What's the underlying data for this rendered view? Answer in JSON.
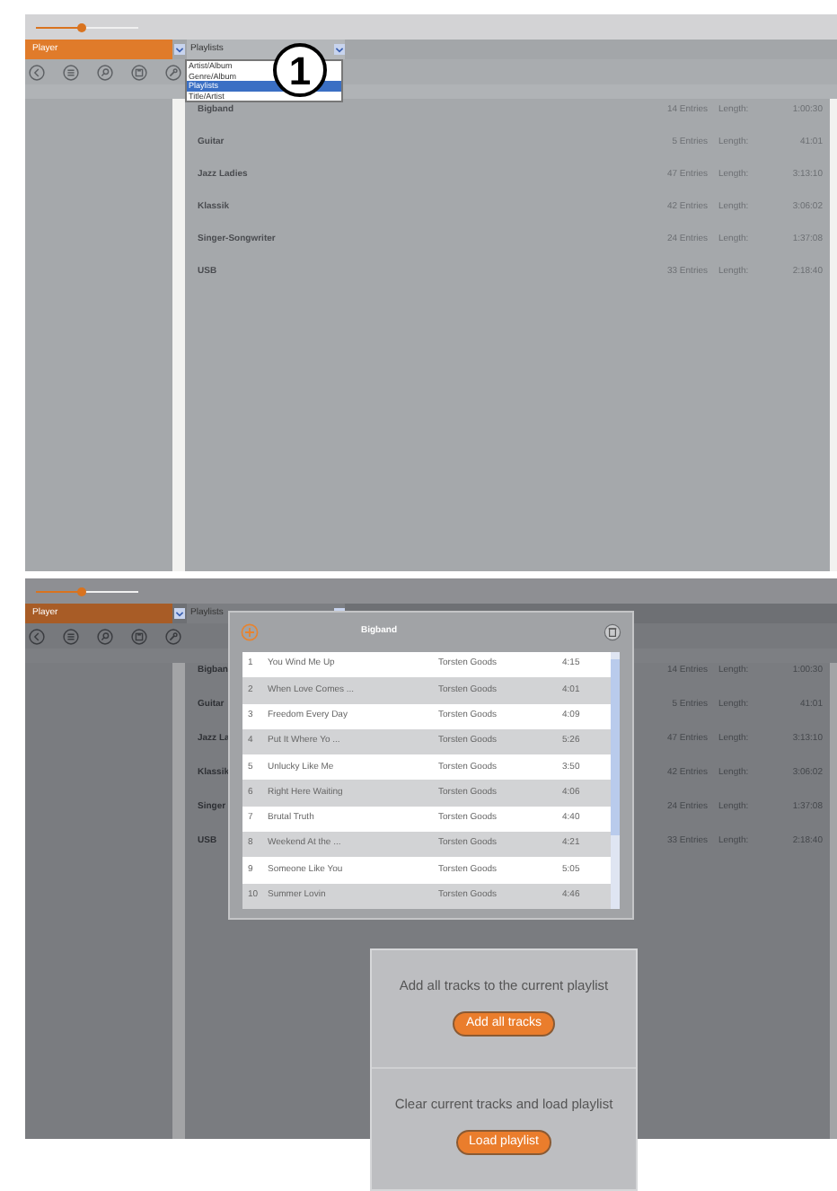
{
  "screen_1": {
    "slider": {
      "level": 0.45
    },
    "view_selector": "Player",
    "source_selector": "Playlists",
    "source_options": [
      {
        "label": "Artist/Album",
        "selected": false
      },
      {
        "label": "Genre/Album",
        "selected": false
      },
      {
        "label": "Playlists",
        "selected": true
      },
      {
        "label": "Title/Artist",
        "selected": false
      }
    ],
    "callout": "1",
    "playlists": [
      {
        "name": "Bigband",
        "entries": "14 Entries",
        "length_label": "Length:",
        "length": "1:00:30"
      },
      {
        "name": "Guitar",
        "entries": "5 Entries",
        "length_label": "Length:",
        "length": "41:01"
      },
      {
        "name": "Jazz Ladies",
        "entries": "47 Entries",
        "length_label": "Length:",
        "length": "3:13:10"
      },
      {
        "name": "Klassik",
        "entries": "42 Entries",
        "length_label": "Length:",
        "length": "3:06:02"
      },
      {
        "name": "Singer-Songwriter",
        "entries": "24 Entries",
        "length_label": "Length:",
        "length": "1:37:08"
      },
      {
        "name": "USB",
        "entries": "33 Entries",
        "length_label": "Length:",
        "length": "2:18:40"
      }
    ]
  },
  "screen_2": {
    "slider": {
      "level": 0.45
    },
    "view_selector": "Player",
    "source_selector": "Playlists",
    "playlists": [
      {
        "name": "Bigban",
        "entries": "14 Entries",
        "length_label": "Length:",
        "length": "1:00:30"
      },
      {
        "name": "Guitar",
        "entries": "5 Entries",
        "length_label": "Length:",
        "length": "41:01"
      },
      {
        "name": "Jazz La",
        "entries": "47 Entries",
        "length_label": "Length:",
        "length": "3:13:10"
      },
      {
        "name": "Klassik",
        "entries": "42 Entries",
        "length_label": "Length:",
        "length": "3:06:02"
      },
      {
        "name": "Singer",
        "entries": "24 Entries",
        "length_label": "Length:",
        "length": "1:37:08"
      },
      {
        "name": "USB",
        "entries": "33 Entries",
        "length_label": "Length:",
        "length": "2:18:40"
      }
    ],
    "dialog": {
      "title": "Bigband",
      "tracks": [
        {
          "number": "1",
          "title": "You Wind Me Up",
          "artist": "Torsten Goods",
          "duration": "4:15"
        },
        {
          "number": "2",
          "title": "When Love Comes ...",
          "artist": "Torsten Goods",
          "duration": "4:01"
        },
        {
          "number": "3",
          "title": "Freedom Every Day",
          "artist": "Torsten Goods",
          "duration": "4:09"
        },
        {
          "number": "4",
          "title": "Put It Where Yo ...",
          "artist": "Torsten Goods",
          "duration": "5:26"
        },
        {
          "number": "5",
          "title": "Unlucky Like Me",
          "artist": "Torsten Goods",
          "duration": "3:50"
        },
        {
          "number": "6",
          "title": "Right Here Waiting",
          "artist": "Torsten Goods",
          "duration": "4:06"
        },
        {
          "number": "7",
          "title": "Brutal Truth",
          "artist": "Torsten Goods",
          "duration": "4:40"
        },
        {
          "number": "8",
          "title": "Weekend At the ...",
          "artist": "Torsten Goods",
          "duration": "4:21"
        },
        {
          "number": "9",
          "title": "Someone Like You",
          "artist": "Torsten Goods",
          "duration": "5:05"
        },
        {
          "number": "10",
          "title": "Summer Lovin",
          "artist": "Torsten Goods",
          "duration": "4:46"
        }
      ]
    }
  },
  "load_popup": {
    "sections": [
      {
        "text": "Add all tracks to the current playlist",
        "button": "Add all tracks"
      },
      {
        "text": "Clear current tracks and load playlist",
        "button": "Load playlist"
      }
    ]
  }
}
